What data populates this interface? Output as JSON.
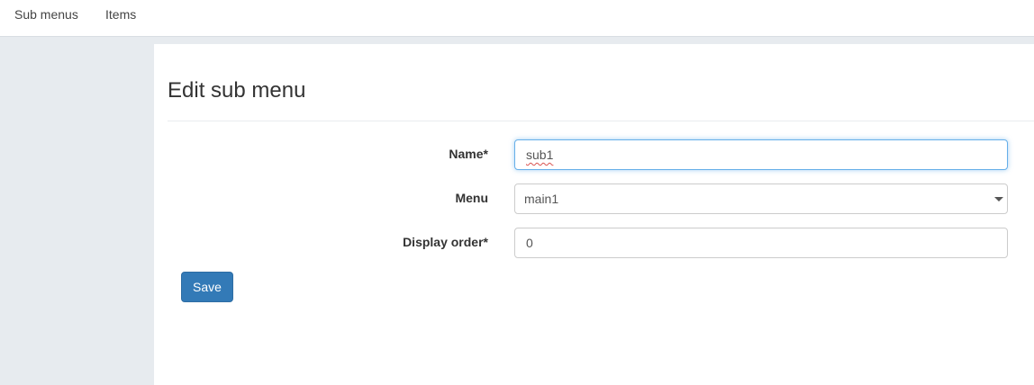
{
  "nav": {
    "items": [
      {
        "label": "Sub menus"
      },
      {
        "label": "Items"
      }
    ]
  },
  "page": {
    "title": "Edit sub menu"
  },
  "form": {
    "name": {
      "label": "Name*",
      "value": "sub1"
    },
    "menu": {
      "label": "Menu",
      "selected": "main1"
    },
    "display_order": {
      "label": "Display order*",
      "value": "0"
    },
    "save_label": "Save"
  },
  "colors": {
    "primary_button": "#337ab7",
    "focus_border": "#66afe9",
    "sidebar_background": "#e7ebef"
  }
}
